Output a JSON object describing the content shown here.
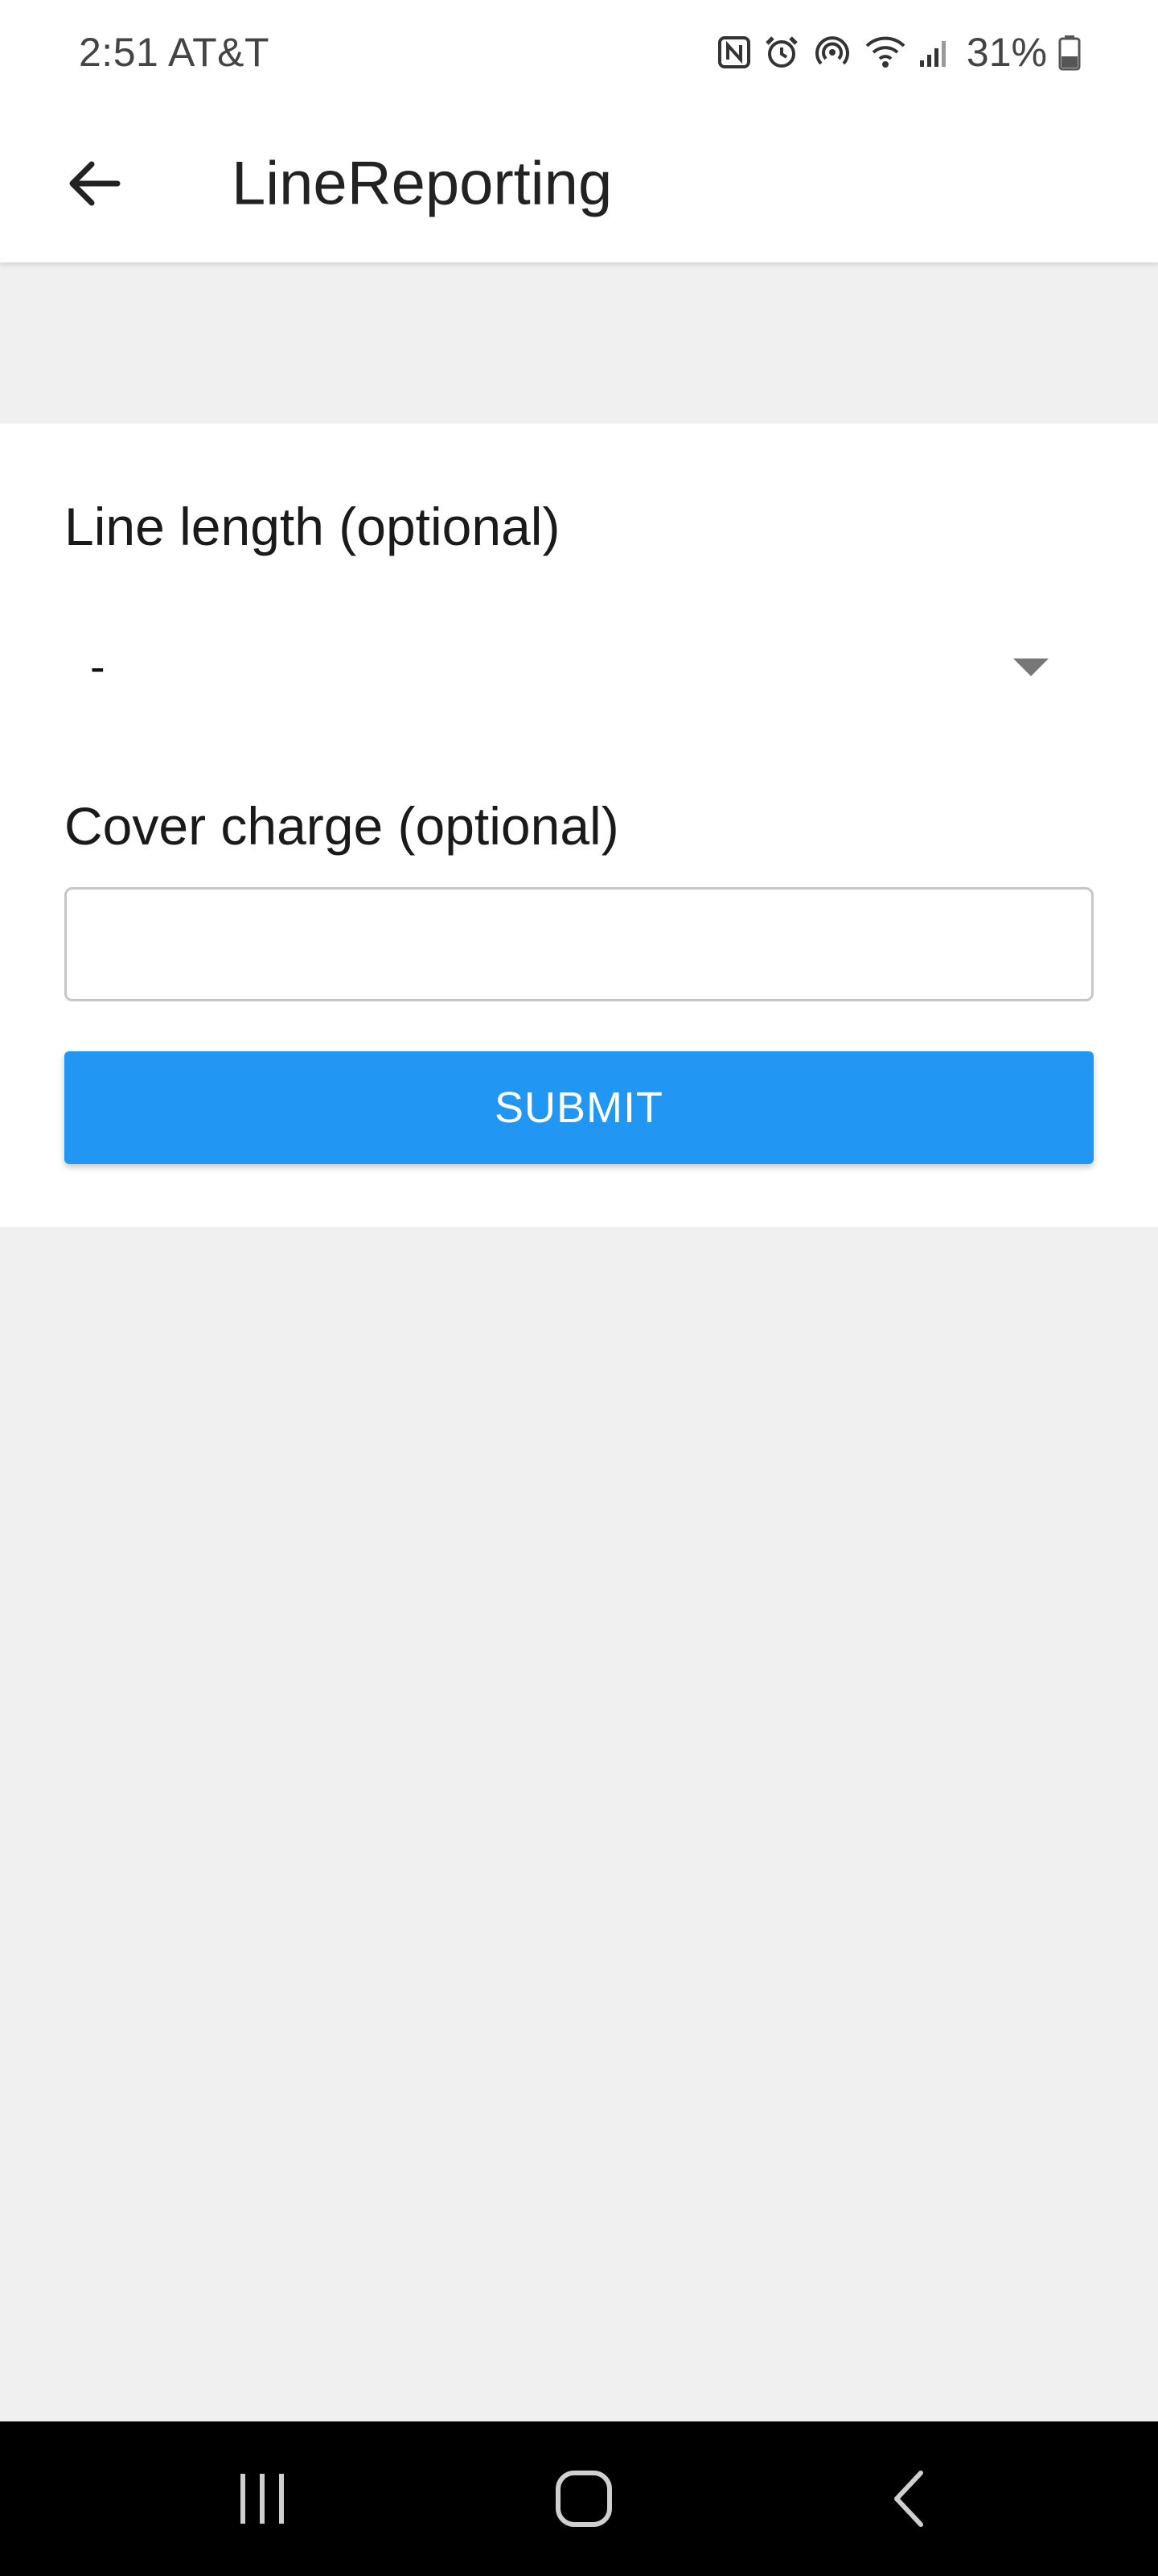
{
  "status_bar": {
    "time_carrier": "2:51 AT&T",
    "battery_percent": "31%",
    "icons": [
      "nfc-icon",
      "alarm-icon",
      "hotspot-icon",
      "wifi-icon",
      "signal-icon",
      "battery-icon"
    ]
  },
  "app_bar": {
    "title": "LineReporting",
    "back_icon": "arrow-left-icon"
  },
  "form": {
    "line_length_label": "Line length (optional)",
    "line_length_value": "-",
    "cover_charge_label": "Cover charge (optional)",
    "cover_charge_value": "",
    "submit_label": "SUBMIT"
  },
  "nav_bar": {
    "icons": [
      "recents-icon",
      "home-icon",
      "back-icon"
    ]
  },
  "colors": {
    "accent": "#2196f3",
    "background": "#f0f0f0",
    "surface": "#ffffff"
  }
}
